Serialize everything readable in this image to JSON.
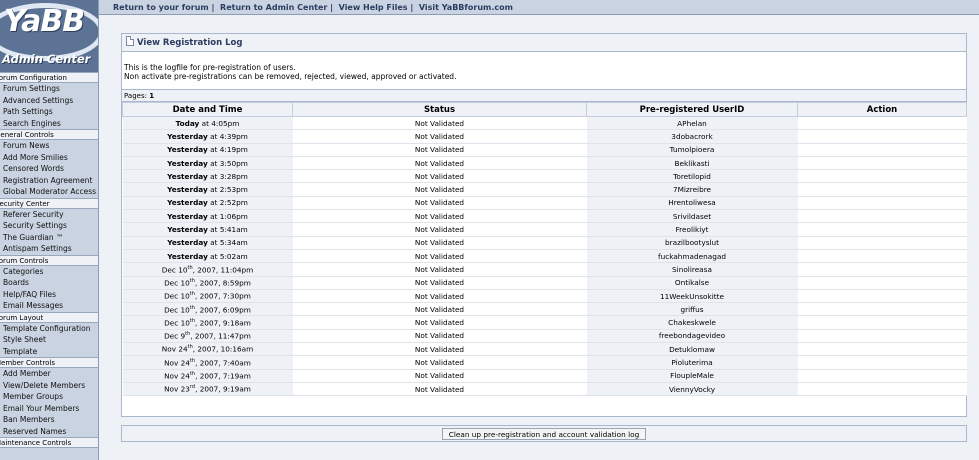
{
  "sidebar": {
    "logo_text": "YaBB",
    "logo_subtext": "Admin Center",
    "sections": [
      {
        "title": "Forum Configuration",
        "items": [
          "Forum Settings",
          "Advanced Settings",
          "Path Settings",
          "Search Engines"
        ]
      },
      {
        "title": "General Controls",
        "items": [
          "Forum News",
          "Add More Smilies",
          "Censored Words",
          "Registration Agreement",
          "Global Moderator Access"
        ]
      },
      {
        "title": "Security Center",
        "items": [
          "Referer Security",
          "Security Settings",
          "The Guardian ™",
          "Antispam Settings"
        ]
      },
      {
        "title": "Forum Controls",
        "items": [
          "Categories",
          "Boards",
          "Help/FAQ Files",
          "Email Messages"
        ]
      },
      {
        "title": "Forum Layout",
        "items": [
          "Template Configuration",
          "Style Sheet",
          "Template"
        ]
      },
      {
        "title": "Member Controls",
        "items": [
          "Add Member",
          "View/Delete Members",
          "Member Groups",
          "Email Your Members",
          "Ban Members",
          "Reserved Names"
        ]
      },
      {
        "title": "Maintenance Controls",
        "items": []
      }
    ]
  },
  "topbar": {
    "links": [
      "Return to your forum",
      "Return to Admin Center",
      "View Help Files",
      "Visit YaBBforum.com"
    ],
    "separator": "|"
  },
  "panel": {
    "title": "View Registration Log",
    "intro_line1": "This is the logfile for pre-registration of users.",
    "intro_line2": "Non activate pre-registrations can be removed, rejected, viewed, approved or activated.",
    "pages_label": "Pages:",
    "pages_value": "1"
  },
  "table": {
    "headers": [
      "Date and Time",
      "Status",
      "Pre-registered UserID",
      "Action"
    ],
    "rows": [
      {
        "date_bold": "Today",
        "date_rest": " at 4:05pm",
        "status": "Not Validated",
        "user": "APhelan"
      },
      {
        "date_bold": "Yesterday",
        "date_rest": " at 4:39pm",
        "status": "Not Validated",
        "user": "3dobacrork"
      },
      {
        "date_bold": "Yesterday",
        "date_rest": " at 4:19pm",
        "status": "Not Validated",
        "user": "Tumolpioera"
      },
      {
        "date_bold": "Yesterday",
        "date_rest": " at 3:50pm",
        "status": "Not Validated",
        "user": "Beklikasti"
      },
      {
        "date_bold": "Yesterday",
        "date_rest": " at 3:28pm",
        "status": "Not Validated",
        "user": "Toretilopid"
      },
      {
        "date_bold": "Yesterday",
        "date_rest": " at 2:53pm",
        "status": "Not Validated",
        "user": "7Mizreibre"
      },
      {
        "date_bold": "Yesterday",
        "date_rest": " at 2:52pm",
        "status": "Not Validated",
        "user": "Hrentoliwesa"
      },
      {
        "date_bold": "Yesterday",
        "date_rest": " at 1:06pm",
        "status": "Not Validated",
        "user": "Srivildaset"
      },
      {
        "date_bold": "Yesterday",
        "date_rest": " at 5:41am",
        "status": "Not Validated",
        "user": "Freolikiyt"
      },
      {
        "date_bold": "Yesterday",
        "date_rest": " at 5:34am",
        "status": "Not Validated",
        "user": "brazilbootyslut"
      },
      {
        "date_bold": "Yesterday",
        "date_rest": " at 5:02am",
        "status": "Not Validated",
        "user": "fuckahmadenagad"
      },
      {
        "date_pre": "Dec 10",
        "date_sup": "th",
        "date_post": ", 2007, 11:04pm",
        "status": "Not Validated",
        "user": "Sinolireasa"
      },
      {
        "date_pre": "Dec 10",
        "date_sup": "th",
        "date_post": ", 2007, 8:59pm",
        "status": "Not Validated",
        "user": "Ontikalse"
      },
      {
        "date_pre": "Dec 10",
        "date_sup": "th",
        "date_post": ", 2007, 7:30pm",
        "status": "Not Validated",
        "user": "11WeekUnsokitte"
      },
      {
        "date_pre": "Dec 10",
        "date_sup": "th",
        "date_post": ", 2007, 6:09pm",
        "status": "Not Validated",
        "user": "griffus"
      },
      {
        "date_pre": "Dec 10",
        "date_sup": "th",
        "date_post": ", 2007, 9:18am",
        "status": "Not Validated",
        "user": "Chakeskwele"
      },
      {
        "date_pre": "Dec 9",
        "date_sup": "th",
        "date_post": ", 2007, 11:47pm",
        "status": "Not Validated",
        "user": "freebondagevideo"
      },
      {
        "date_pre": "Nov 24",
        "date_sup": "th",
        "date_post": ", 2007, 10:16am",
        "status": "Not Validated",
        "user": "Detuklomaw"
      },
      {
        "date_pre": "Nov 24",
        "date_sup": "th",
        "date_post": ", 2007, 7:40am",
        "status": "Not Validated",
        "user": "Pioluterima"
      },
      {
        "date_pre": "Nov 24",
        "date_sup": "th",
        "date_post": ", 2007, 7:19am",
        "status": "Not Validated",
        "user": "FloupleMale"
      },
      {
        "date_pre": "Nov 23",
        "date_sup": "rd",
        "date_post": ", 2007, 9:19am",
        "status": "Not Validated",
        "user": "ViennyVocky"
      }
    ]
  },
  "bottom": {
    "cleanup_label": "Clean up pre-registration and account validation log"
  }
}
